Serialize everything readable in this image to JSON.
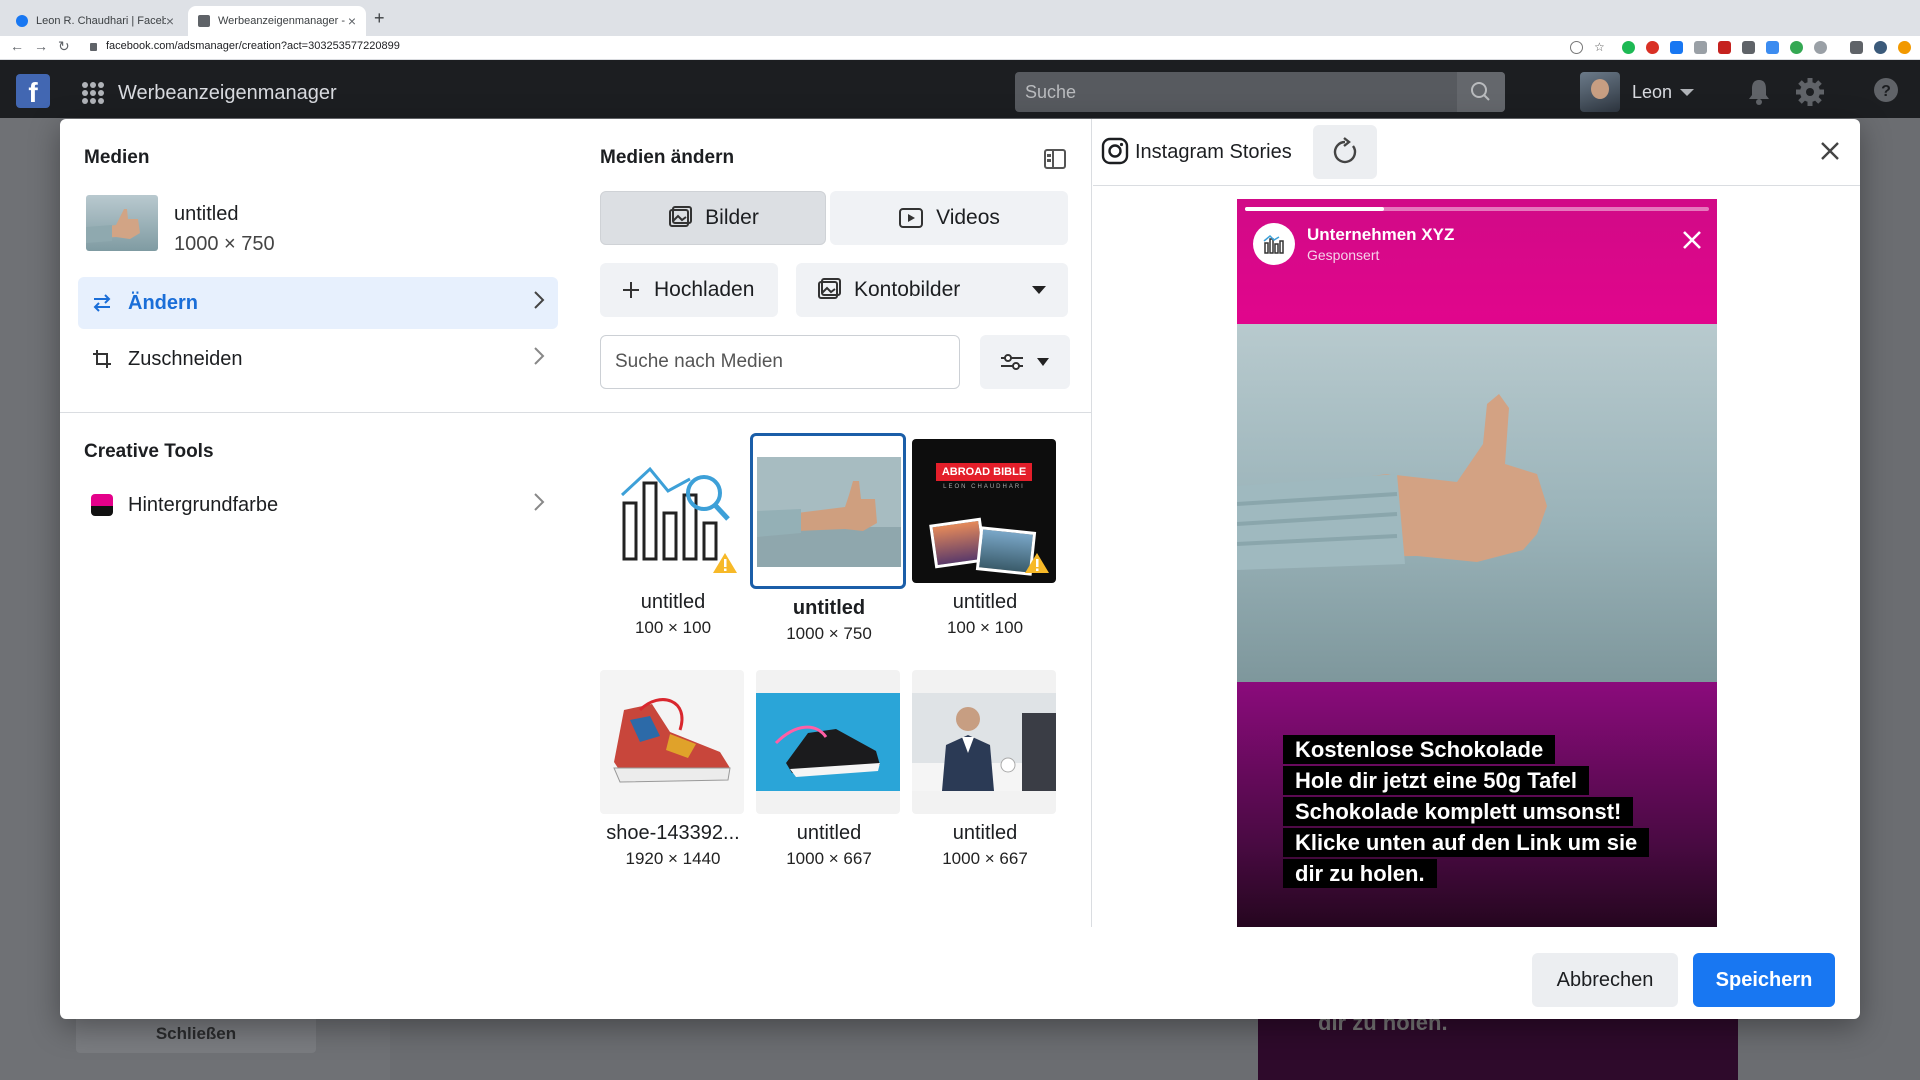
{
  "browser": {
    "tabs": [
      {
        "label": "Leon R. Chaudhari | Facebook"
      },
      {
        "label": "Werbeanzeigenmanager - Crea"
      }
    ],
    "url": "facebook.com/adsmanager/creation?act=303253577220899"
  },
  "fbbar": {
    "app_name": "Werbeanzeigenmanager",
    "search_placeholder": "Suche",
    "user_name": "Leon"
  },
  "background": {
    "close_label": "Schließen",
    "story_text": "dir zu holen."
  },
  "left_panel": {
    "title": "Medien",
    "media": {
      "name": "untitled",
      "dims": "1000 × 750"
    },
    "actions": [
      {
        "label": "Ändern",
        "icon": "swap-arrows-icon",
        "active": true
      },
      {
        "label": "Zuschneiden",
        "icon": "crop-icon",
        "active": false
      }
    ],
    "creative_title": "Creative Tools",
    "creative_items": [
      {
        "label": "Hintergrundfarbe",
        "icon": "color-swatch-icon"
      }
    ]
  },
  "middle_panel": {
    "title": "Medien ändern",
    "tabs": [
      {
        "label": "Bilder",
        "icon": "image-icon",
        "selected": true
      },
      {
        "label": "Videos",
        "icon": "video-icon",
        "selected": false
      }
    ],
    "upload_label": "Hochladen",
    "account_images_label": "Kontobilder",
    "search_placeholder": "Suche nach Medien",
    "tiles": [
      {
        "name": "untitled",
        "dims": "100 × 100",
        "kind": "chart-logo",
        "warning": true,
        "selected": false
      },
      {
        "name": "untitled",
        "dims": "1000 × 750",
        "kind": "thumb",
        "warning": false,
        "selected": true
      },
      {
        "name": "untitled",
        "dims": "100 × 100",
        "kind": "abroad",
        "warning": true,
        "selected": false
      },
      {
        "name": "shoe-143392...",
        "dims": "1920 × 1440",
        "kind": "sneaker",
        "warning": false,
        "selected": false
      },
      {
        "name": "untitled",
        "dims": "1000 × 667",
        "kind": "shoe-blue",
        "warning": false,
        "selected": false
      },
      {
        "name": "untitled",
        "dims": "1000 × 667",
        "kind": "business",
        "warning": false,
        "selected": false
      }
    ],
    "abroad_logo_text": "ABROAD BIBLE",
    "abroad_sub_text": "LEON CHAUDHARI"
  },
  "preview": {
    "placement": "Instagram Stories",
    "company": "Unternehmen XYZ",
    "sponsored": "Gesponsert",
    "story_lines": [
      "Kostenlose Schokolade",
      "Hole dir jetzt eine 50g Tafel",
      "Schokolade komplett umsonst!",
      "Klicke unten auf den Link um sie",
      "dir zu holen."
    ]
  },
  "footer": {
    "cancel_label": "Abbrechen",
    "save_label": "Speichern"
  }
}
